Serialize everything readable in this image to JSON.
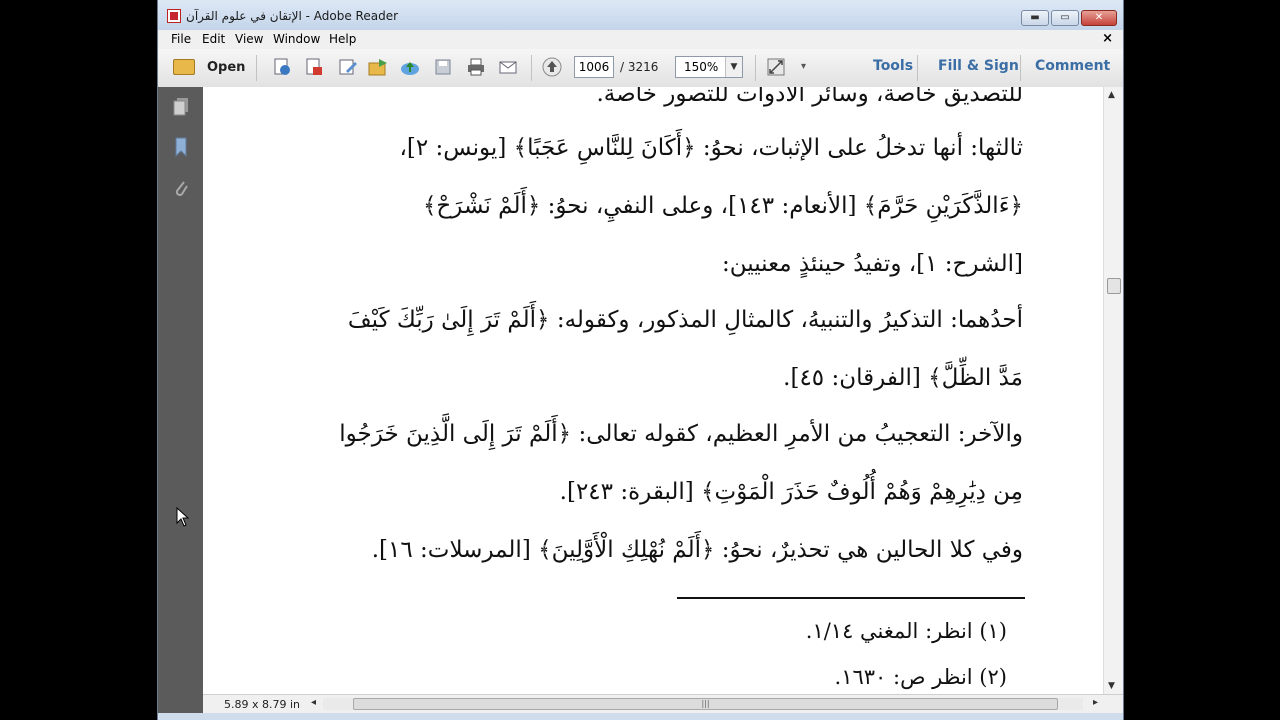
{
  "window": {
    "title": "الإتقان في علوم القرآن - Adobe Reader",
    "controls": {
      "minimize": "▬",
      "maximize": "▭",
      "close": "✕"
    }
  },
  "menu": {
    "items": [
      "File",
      "Edit",
      "View",
      "Window",
      "Help"
    ],
    "close_glyph": "×"
  },
  "toolbar": {
    "open_label": "Open",
    "page_current": "1006",
    "page_total": "/ 3216",
    "zoom": "150%",
    "right_tabs": [
      "Tools",
      "Fill & Sign",
      "Comment"
    ]
  },
  "document": {
    "lines": [
      "للتصديق خاصة، وسائر الأدوات للتصور خاصة.",
      "ثالثها: أنها تدخلُ على الإثبات، نحوُ: ﴿أَكَانَ لِلنَّاسِ عَجَبًا﴾ [يونس: ٢]،",
      "﴿ءَالذَّكَرَيْنِ حَرَّمَ﴾ [الأنعام: ١٤٣]، وعلى النفيِ، نحوُ: ﴿أَلَمْ نَشْرَحْ﴾",
      "[الشرح: ١]، وتفيدُ حينئذٍ معنيين:",
      "أحدُهما: التذكيرُ والتنبيهُ، كالمثالِ المذكور، وكقوله: ﴿أَلَمْ تَرَ إِلَىٰ رَبِّكَ كَيْفَ",
      "مَدَّ الظِّلَّ﴾ [الفرقان: ٤٥].",
      "والآخر: التعجيبُ من الأمرِ العظيم، كقوله تعالى: ﴿أَلَمْ تَرَ إِلَى الَّذِينَ خَرَجُوا",
      "مِن دِيَٰرِهِمْ وَهُمْ أُلُوفٌ حَذَرَ الْمَوْتِ﴾ [البقرة: ٢٤٣].",
      "وفي كلا الحالين هي تحذيرٌ، نحوُ: ﴿أَلَمْ نُهْلِكِ الْأَوَّلِينَ﴾ [المرسلات: ١٦]."
    ],
    "footnotes": [
      "(١) انظر: المغني ١/١٤.",
      "(٢) انظر ص: ١٦٣٠."
    ]
  },
  "status": {
    "page_size": "5.89 x 8.79 in",
    "scroll_left": "◂",
    "scroll_right": "▸",
    "scroll_grip": "|||"
  },
  "scrollbar": {
    "up": "▲",
    "down": "▼"
  }
}
